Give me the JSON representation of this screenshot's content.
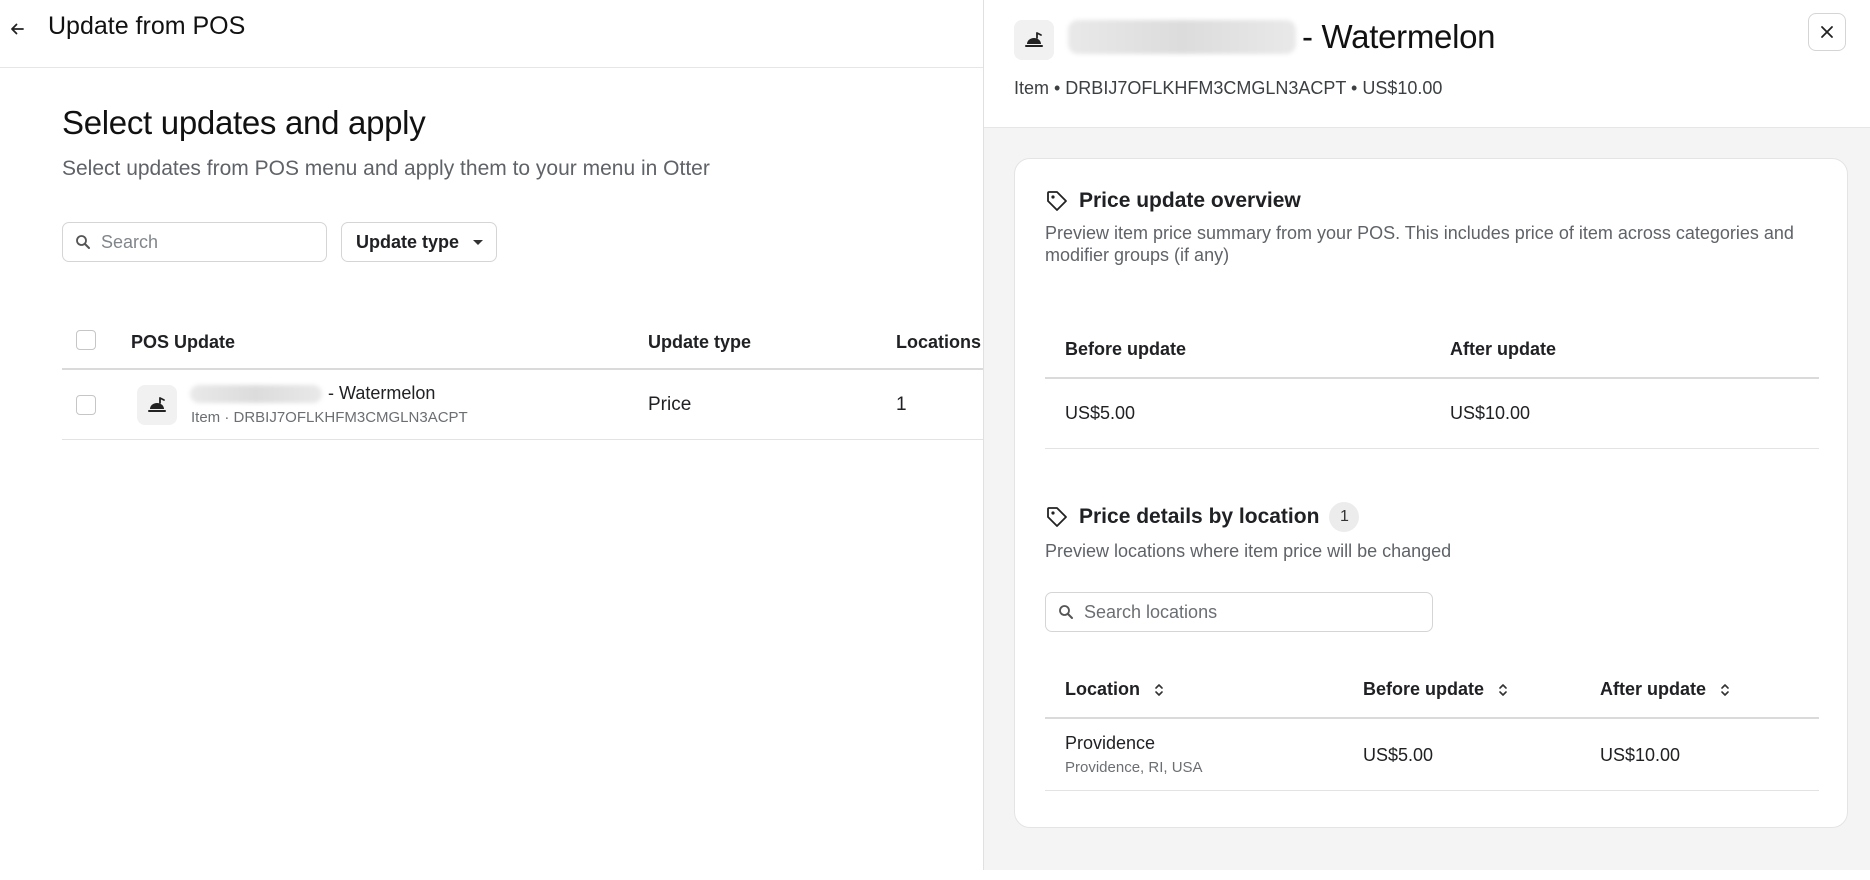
{
  "header": {
    "title": "Update from POS"
  },
  "main": {
    "title": "Select updates and apply",
    "subtitle": "Select updates from POS menu and apply them to your menu in Otter",
    "search": {
      "placeholder": "Search",
      "value": ""
    },
    "filter": {
      "label": "Update type"
    },
    "table": {
      "columns": [
        "POS Update",
        "Update type",
        "Locations"
      ],
      "rows": [
        {
          "name_suffix": "- Watermelon",
          "meta": "Item · DRBIJ7OFLKHFM3CMGLN3ACPT",
          "update_type": "Price",
          "locations": "1"
        }
      ]
    }
  },
  "panel": {
    "title_suffix": "- Watermelon",
    "meta": "Item • DRBIJ7OFLKHFM3CMGLN3ACPT • US$10.00",
    "overview": {
      "title": "Price update overview",
      "description": "Preview item price summary from your POS. This includes price of item across categories and modifier groups (if any)",
      "columns": [
        "Before update",
        "After update"
      ],
      "row": {
        "before": "US$5.00",
        "after": "US$10.00"
      }
    },
    "locations": {
      "title": "Price details by location",
      "count": "1",
      "description": "Preview locations where item price will be changed",
      "search_placeholder": "Search locations",
      "columns": [
        "Location",
        "Before update",
        "After update"
      ],
      "rows": [
        {
          "name": "Providence",
          "address": "Providence, RI, USA",
          "before": "US$5.00",
          "after": "US$10.00"
        }
      ]
    }
  },
  "icons": {
    "back": "arrow-left-icon",
    "search": "search-icon",
    "caret": "caret-down-icon",
    "item": "food-item-icon",
    "close": "close-icon",
    "tag": "price-tag-icon",
    "sort": "sort-icon"
  }
}
